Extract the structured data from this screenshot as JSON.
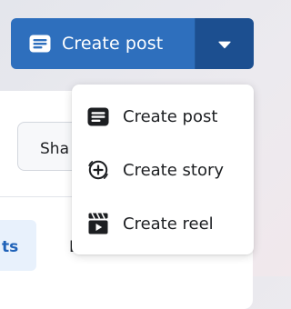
{
  "create_button": {
    "label": "Create post",
    "icon": "post-icon",
    "dropdown_icon": "caret-down-icon",
    "main_color": "#2e6fbd",
    "caret_color": "#1c4f90"
  },
  "menu": {
    "items": [
      {
        "label": "Create post",
        "icon": "post-icon"
      },
      {
        "label": "Create story",
        "icon": "add-circle-icon"
      },
      {
        "label": "Create reel",
        "icon": "clapperboard-icon"
      }
    ]
  },
  "background": {
    "share_label": "Sha",
    "tab_active_label": "ts",
    "tab_next_label": "D"
  }
}
